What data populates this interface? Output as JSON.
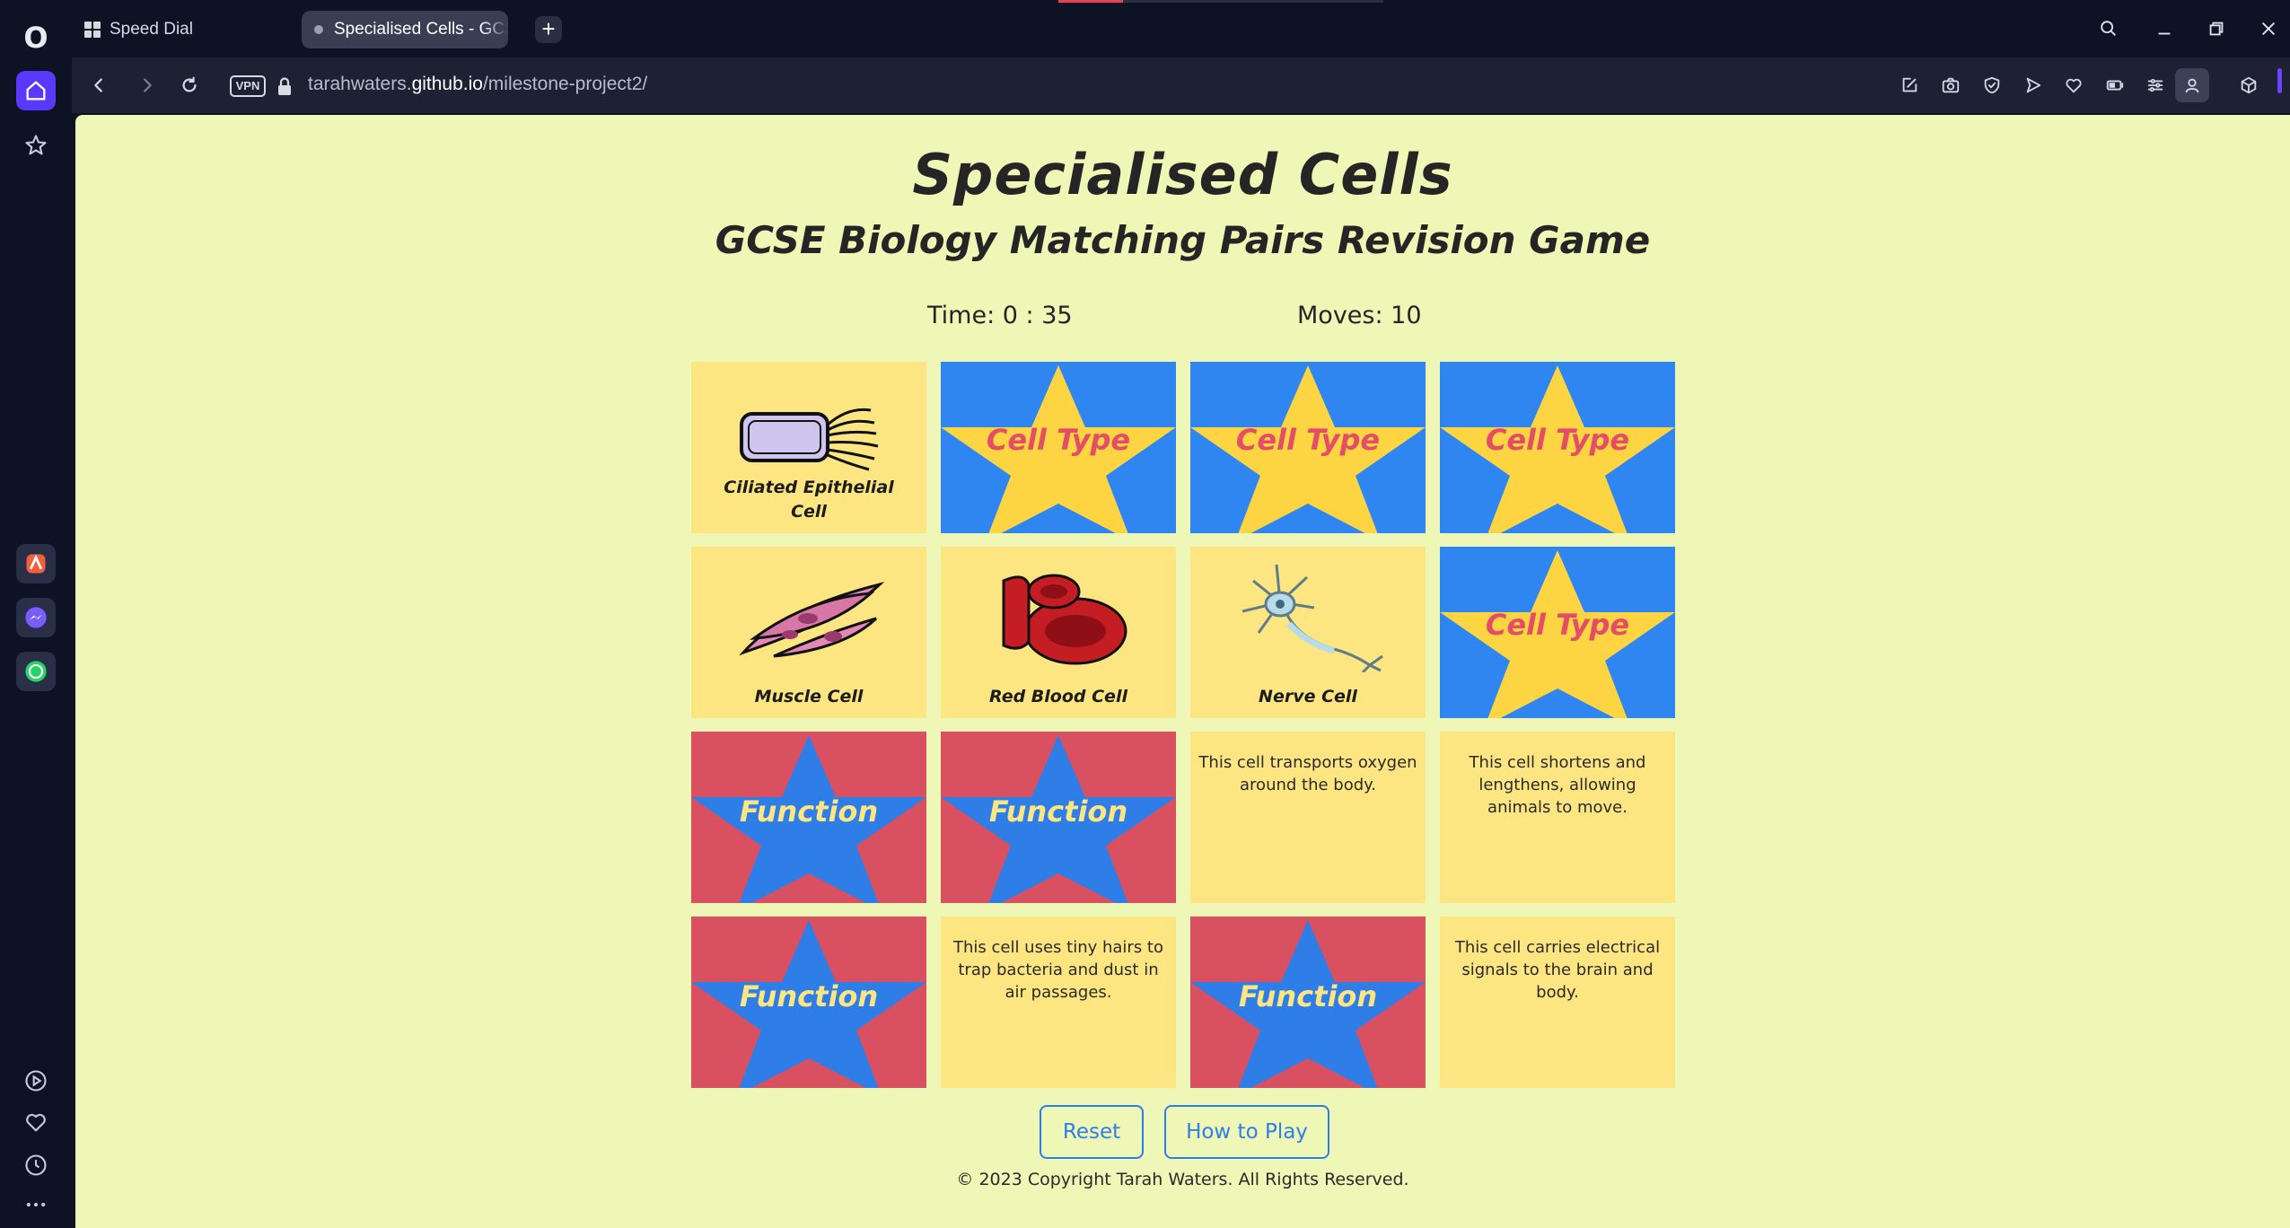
{
  "browser": {
    "tabs": [
      {
        "label": "Speed Dial"
      },
      {
        "label": "Specialised Cells - GCSE Bi"
      }
    ],
    "new_tab": "+",
    "vpn_label": "VPN",
    "url": {
      "prefix": "tarahwaters.",
      "domain": "github.io",
      "path": "/milestone-project2/"
    },
    "accent_color": "#5a38ff"
  },
  "page": {
    "title": "Specialised Cells",
    "subtitle": "GCSE Biology Matching Pairs Revision Game",
    "time": "Time: 0 : 35",
    "moves": "Moves: 10",
    "reset_label": "Reset",
    "how_to_play_label": "How to Play",
    "footer": "© 2023 Copyright Tarah Waters. All Rights Reserved.",
    "colors": {
      "background": "#eef7b6",
      "card_face": "#fde682",
      "cell_back": "#2f86f0",
      "function_back": "#d95060",
      "star": "#fdd442",
      "button": "#2f7ee8"
    }
  },
  "cards": [
    {
      "state": "face",
      "kind": "image",
      "icon": "ciliated-epithelial-cell",
      "label": "Ciliated Epithelial Cell"
    },
    {
      "state": "back",
      "kind": "cell",
      "label": "Cell Type"
    },
    {
      "state": "back",
      "kind": "cell",
      "label": "Cell Type"
    },
    {
      "state": "back",
      "kind": "cell",
      "label": "Cell Type"
    },
    {
      "state": "face",
      "kind": "image",
      "icon": "muscle-cell",
      "label": "Muscle Cell"
    },
    {
      "state": "face",
      "kind": "image",
      "icon": "red-blood-cell",
      "label": "Red Blood Cell"
    },
    {
      "state": "face",
      "kind": "image",
      "icon": "nerve-cell",
      "label": "Nerve Cell"
    },
    {
      "state": "back",
      "kind": "cell",
      "label": "Cell Type"
    },
    {
      "state": "back",
      "kind": "function",
      "label": "Function"
    },
    {
      "state": "back",
      "kind": "function",
      "label": "Function"
    },
    {
      "state": "face",
      "kind": "text",
      "label": "This cell transports oxygen around the body."
    },
    {
      "state": "face",
      "kind": "text",
      "label": "This cell shortens and lengthens, allowing animals to move."
    },
    {
      "state": "back",
      "kind": "function",
      "label": "Function"
    },
    {
      "state": "face",
      "kind": "text",
      "label": "This cell uses tiny hairs to trap bacteria and dust in air passages."
    },
    {
      "state": "back",
      "kind": "function",
      "label": "Function"
    },
    {
      "state": "face",
      "kind": "text",
      "label": "This cell carries electrical signals to the brain and body."
    }
  ]
}
